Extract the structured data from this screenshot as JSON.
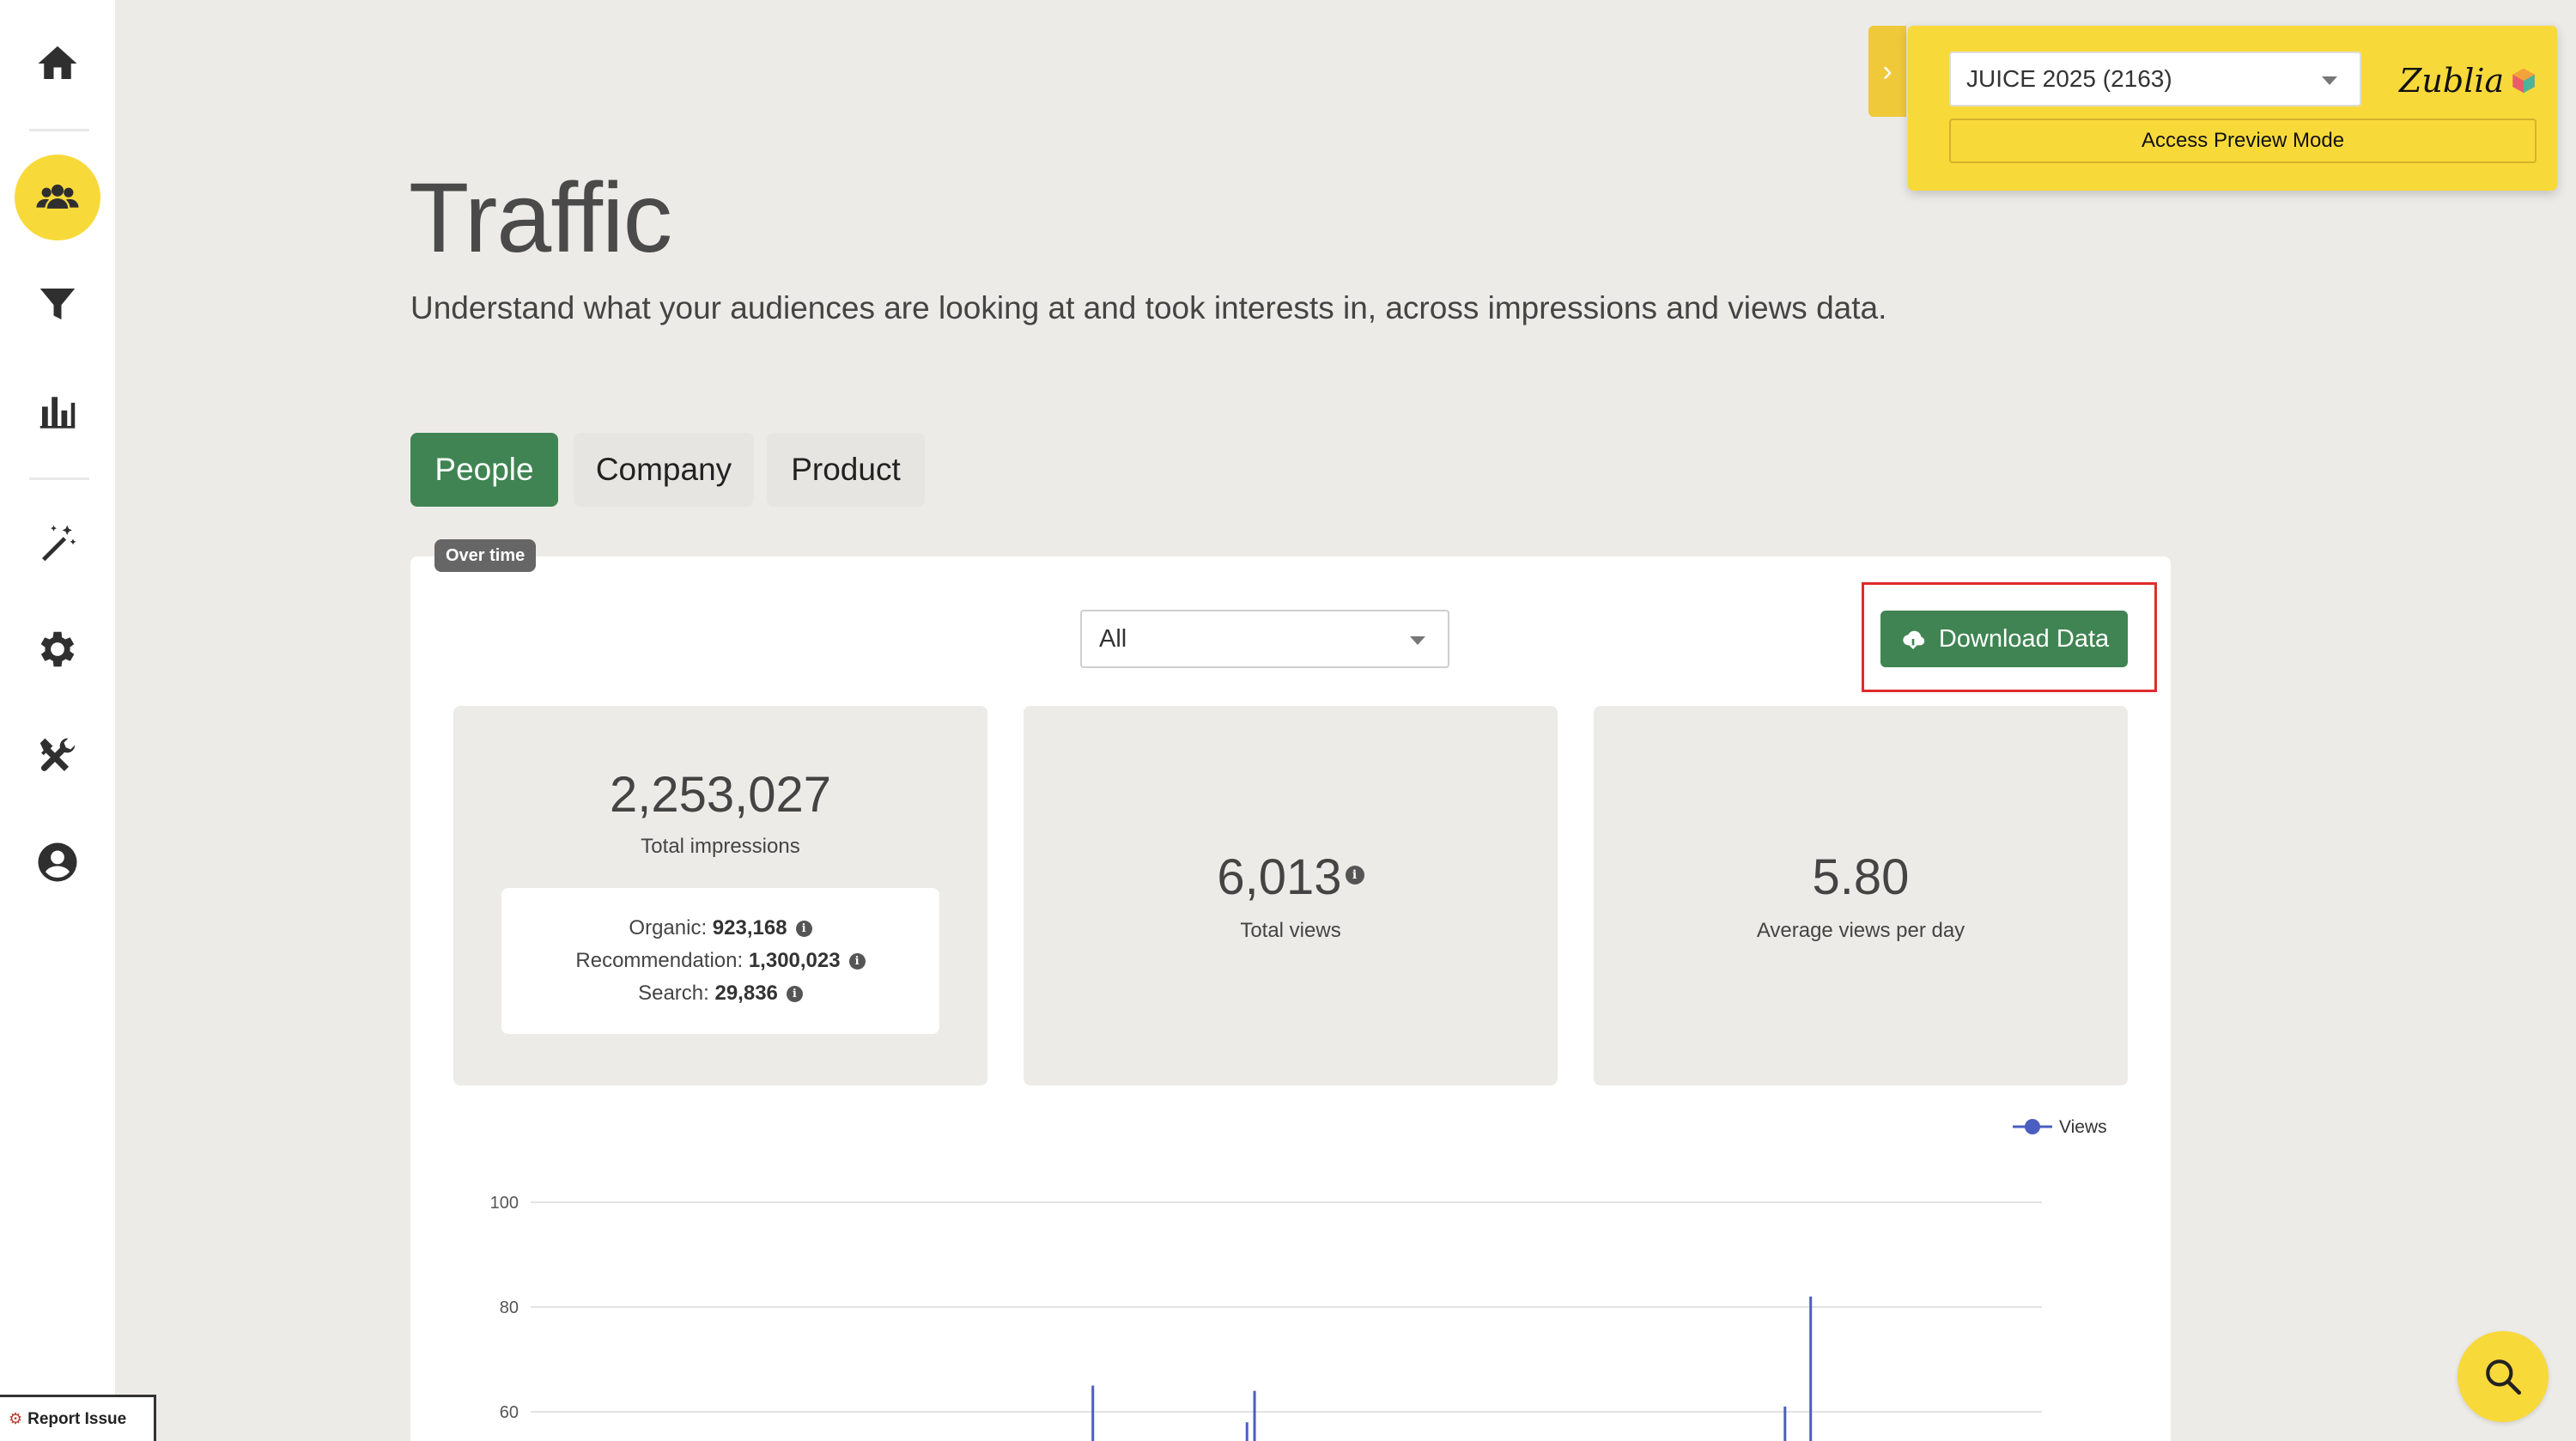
{
  "sidebar": {
    "items": [
      {
        "name": "home-icon"
      },
      {
        "name": "audience-icon",
        "active": true
      },
      {
        "name": "filter-icon"
      },
      {
        "name": "bar-chart-icon"
      },
      {
        "name": "magic-wand-icon"
      },
      {
        "name": "gear-icon"
      },
      {
        "name": "tools-icon"
      },
      {
        "name": "user-circle-icon"
      }
    ],
    "report_issue_label": "Report Issue"
  },
  "page": {
    "title": "Traffic",
    "subtitle": "Understand what your audiences are looking at and took interests in, across impressions and views data."
  },
  "tabs": [
    {
      "label": "People",
      "active": true
    },
    {
      "label": "Company",
      "active": false
    },
    {
      "label": "Product",
      "active": false
    }
  ],
  "card": {
    "badge": "Over time",
    "filter_value": "All",
    "download_label": "Download Data"
  },
  "stats": {
    "impressions": {
      "value": "2,253,027",
      "label": "Total impressions",
      "breakdown": [
        {
          "label": "Organic:",
          "value": "923,168"
        },
        {
          "label": "Recommendation:",
          "value": "1,300,023"
        },
        {
          "label": "Search:",
          "value": "29,836"
        }
      ]
    },
    "views": {
      "value": "6,013",
      "label": "Total views"
    },
    "average": {
      "value": "5.80",
      "label": "Average views per day"
    }
  },
  "preview": {
    "org_select_value": "JUICE 2025 (2163)",
    "brand_name": "Zublia",
    "access_label": "Access Preview Mode"
  },
  "colors": {
    "accent_green": "#3f8452",
    "brand_yellow": "#f8d93a",
    "series_blue": "#4a5fc1",
    "highlight_red": "#e02b2b"
  },
  "chart_data": {
    "type": "line",
    "series": [
      {
        "name": "Views",
        "values": [
          0,
          65,
          0,
          64,
          0,
          61,
          82,
          0
        ]
      }
    ],
    "x_fraction": [
      0.0,
      0.372,
      0.372,
      0.479,
      0.479,
      0.83,
      0.847,
      1.0
    ],
    "ylim": [
      55,
      100
    ],
    "y_ticks": [
      60,
      80,
      100
    ],
    "legend": "top-right",
    "grid": true
  }
}
